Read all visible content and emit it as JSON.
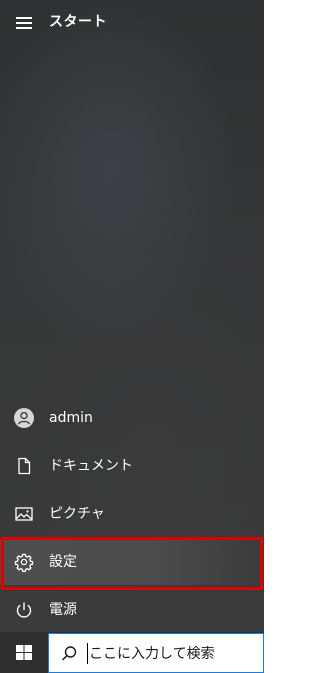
{
  "start_menu": {
    "title": "スタート",
    "items": [
      {
        "label": "admin",
        "icon": "user-avatar-icon"
      },
      {
        "label": "ドキュメント",
        "icon": "document-icon"
      },
      {
        "label": "ピクチャ",
        "icon": "pictures-icon"
      },
      {
        "label": "設定",
        "icon": "gear-icon",
        "highlighted": true
      },
      {
        "label": "電源",
        "icon": "power-icon"
      }
    ]
  },
  "taskbar": {
    "start_icon": "windows-logo-icon",
    "search": {
      "placeholder": "ここに入力して検索",
      "icon": "search-icon"
    }
  },
  "colors": {
    "highlight_frame": "#e00000",
    "search_border": "#1e7ad6",
    "text": "#ffffff"
  }
}
